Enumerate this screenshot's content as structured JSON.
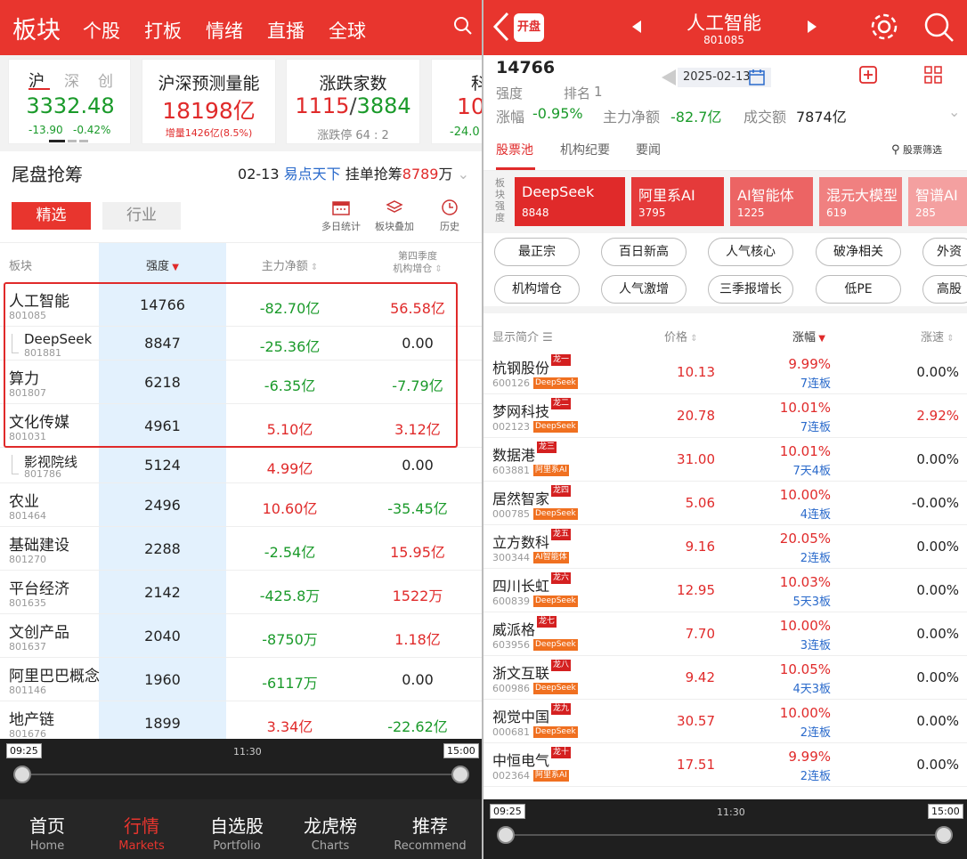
{
  "left": {
    "header": {
      "title": "板块",
      "tabs": [
        "个股",
        "打板",
        "情绪",
        "直播",
        "全球"
      ]
    },
    "index_card": {
      "tabs": [
        "沪",
        "深",
        "创"
      ],
      "value": "3332.48",
      "change": "-13.90",
      "change_pct": "-0.42%"
    },
    "volume_card": {
      "title": "沪深预测量能",
      "value": "18198亿",
      "sub": "增量1426亿(8.5%)"
    },
    "updown_card": {
      "title": "涨跌家数",
      "up": "1115",
      "sep": "/",
      "down": "3884",
      "sub": "涨跌停 64 : 2"
    },
    "extra_card": {
      "title": "科",
      "value": "10",
      "sub": "-24.0"
    },
    "section": {
      "title": "尾盘抢筹",
      "date": "02-13",
      "source": "易点天下",
      "text": "挂单抢筹",
      "amount": "8789",
      "unit": "万"
    },
    "filters": {
      "active": "精选",
      "inactive": "行业"
    },
    "tools": [
      "多日统计",
      "板块叠加",
      "历史"
    ],
    "columns": [
      "板块",
      "强度",
      "主力净额",
      "第四季度",
      "机构增仓"
    ],
    "rows": [
      {
        "name": "人工智能",
        "code": "801085",
        "strength": "14766",
        "net": "-82.70亿",
        "inst": "56.58亿",
        "net_c": "green",
        "inst_c": "red",
        "sub": false
      },
      {
        "name": "DeepSeek",
        "code": "801881",
        "strength": "8847",
        "net": "-25.36亿",
        "inst": "0.00",
        "net_c": "green",
        "inst_c": "none",
        "sub": true
      },
      {
        "name": "算力",
        "code": "801807",
        "strength": "6218",
        "net": "-6.35亿",
        "inst": "-7.79亿",
        "net_c": "green",
        "inst_c": "green",
        "sub": false
      },
      {
        "name": "文化传媒",
        "code": "801031",
        "strength": "4961",
        "net": "5.10亿",
        "inst": "3.12亿",
        "net_c": "red",
        "inst_c": "red",
        "sub": false
      },
      {
        "name": "影视院线",
        "code": "801786",
        "strength": "5124",
        "net": "4.99亿",
        "inst": "0.00",
        "net_c": "red",
        "inst_c": "none",
        "sub": true
      },
      {
        "name": "农业",
        "code": "801464",
        "strength": "2496",
        "net": "10.60亿",
        "inst": "-35.45亿",
        "net_c": "red",
        "inst_c": "green",
        "sub": false
      },
      {
        "name": "基础建设",
        "code": "801270",
        "strength": "2288",
        "net": "-2.54亿",
        "inst": "15.95亿",
        "net_c": "green",
        "inst_c": "red",
        "sub": false
      },
      {
        "name": "平台经济",
        "code": "801635",
        "strength": "2142",
        "net": "-425.8万",
        "inst": "1522万",
        "net_c": "green",
        "inst_c": "red",
        "sub": false
      },
      {
        "name": "文创产品",
        "code": "801637",
        "strength": "2040",
        "net": "-8750万",
        "inst": "1.18亿",
        "net_c": "green",
        "inst_c": "red",
        "sub": false
      },
      {
        "name": "阿里巴巴概念",
        "code": "801146",
        "strength": "1960",
        "net": "-6117万",
        "inst": "0.00",
        "net_c": "green",
        "inst_c": "none",
        "sub": false
      },
      {
        "name": "地产链",
        "code": "801676",
        "strength": "1899",
        "net": "3.34亿",
        "inst": "-22.62亿",
        "net_c": "red",
        "inst_c": "green",
        "sub": false
      }
    ],
    "timeline": {
      "start": "09:25",
      "mid": "11:30",
      "end": "15:00"
    },
    "nav": [
      {
        "zh": "首页",
        "en": "Home"
      },
      {
        "zh": "行情",
        "en": "Markets"
      },
      {
        "zh": "自选股",
        "en": "Portfolio"
      },
      {
        "zh": "龙虎榜",
        "en": "Charts"
      },
      {
        "zh": "推荐",
        "en": "Recommend"
      }
    ]
  },
  "right": {
    "header": {
      "badge": "开盘",
      "title": "人工智能",
      "code": "801085"
    },
    "info": {
      "strength_value": "14766",
      "strength_label": "强度",
      "rank_label": "排名",
      "rank_value": "1",
      "date": "2025-02-13",
      "change_label": "涨幅",
      "change_value": "-0.95%",
      "net_label": "主力净额",
      "net_value": "-82.7亿",
      "turnover_label": "成交额",
      "turnover_value": "7874亿"
    },
    "tabs": [
      "股票池",
      "机构纪要",
      "要闻"
    ],
    "filter_label": "股票筛选",
    "bands_label": "板块强度",
    "bands": [
      {
        "name": "DeepSeek",
        "value": "8848",
        "color": "#e02a2a"
      },
      {
        "name": "阿里系AI",
        "value": "3795",
        "color": "#e53a3a"
      },
      {
        "name": "AI智能体",
        "value": "1225",
        "color": "#ec6464"
      },
      {
        "name": "混元大模型",
        "value": "619",
        "color": "#f08080"
      },
      {
        "name": "智谱AI",
        "value": "285",
        "color": "#f4a0a0"
      }
    ],
    "chips_row1": [
      "最正宗",
      "百日新高",
      "人气核心",
      "破净相关",
      "外资"
    ],
    "chips_row2": [
      "机构增仓",
      "人气激增",
      "三季报增长",
      "低PE",
      "高股"
    ],
    "columns": [
      "显示简介",
      "价格",
      "涨幅",
      "涨速"
    ],
    "stocks": [
      {
        "name": "杭钢股份",
        "rank": "龙一",
        "code": "600126",
        "tag": "DeepSeek",
        "price": "10.13",
        "change": "9.99%",
        "streak": "7连板",
        "speed": "0.00%",
        "speed_c": "none"
      },
      {
        "name": "梦网科技",
        "rank": "龙二",
        "code": "002123",
        "tag": "DeepSeek",
        "price": "20.78",
        "change": "10.01%",
        "streak": "7连板",
        "speed": "2.92%",
        "speed_c": "red"
      },
      {
        "name": "数据港",
        "rank": "龙三",
        "code": "603881",
        "tag": "阿里系AI",
        "price": "31.00",
        "change": "10.01%",
        "streak": "7天4板",
        "speed": "0.00%",
        "speed_c": "none"
      },
      {
        "name": "居然智家",
        "rank": "龙四",
        "code": "000785",
        "tag": "DeepSeek",
        "price": "5.06",
        "change": "10.00%",
        "streak": "4连板",
        "speed": "-0.00%",
        "speed_c": "none"
      },
      {
        "name": "立方数科",
        "rank": "龙五",
        "code": "300344",
        "tag": "AI智能体",
        "price": "9.16",
        "change": "20.05%",
        "streak": "2连板",
        "speed": "0.00%",
        "speed_c": "none"
      },
      {
        "name": "四川长虹",
        "rank": "龙六",
        "code": "600839",
        "tag": "DeepSeek",
        "price": "12.95",
        "change": "10.03%",
        "streak": "5天3板",
        "speed": "0.00%",
        "speed_c": "none"
      },
      {
        "name": "威派格",
        "rank": "龙七",
        "code": "603956",
        "tag": "DeepSeek",
        "price": "7.70",
        "change": "10.00%",
        "streak": "3连板",
        "speed": "0.00%",
        "speed_c": "none"
      },
      {
        "name": "浙文互联",
        "rank": "龙八",
        "code": "600986",
        "tag": "DeepSeek",
        "price": "9.42",
        "change": "10.05%",
        "streak": "4天3板",
        "speed": "0.00%",
        "speed_c": "none"
      },
      {
        "name": "视觉中国",
        "rank": "龙九",
        "code": "000681",
        "tag": "DeepSeek",
        "price": "30.57",
        "change": "10.00%",
        "streak": "2连板",
        "speed": "0.00%",
        "speed_c": "none"
      },
      {
        "name": "中恒电气",
        "rank": "龙十",
        "code": "002364",
        "tag": "阿里系AI",
        "price": "17.51",
        "change": "9.99%",
        "streak": "2连板",
        "speed": "0.00%",
        "speed_c": "none"
      }
    ],
    "timeline": {
      "start": "09:25",
      "mid": "11:30",
      "end": "15:00"
    }
  }
}
